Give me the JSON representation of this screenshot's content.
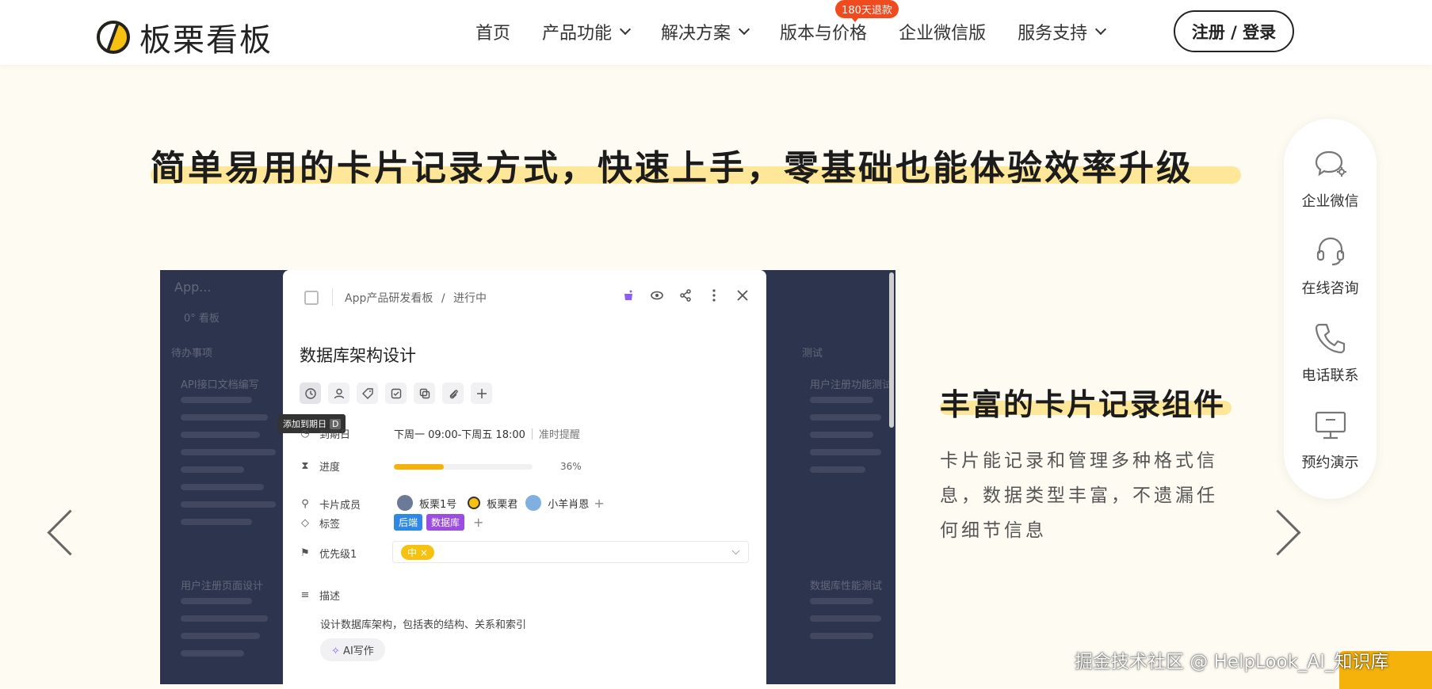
{
  "header": {
    "logo_text": "板栗看板",
    "nav": [
      {
        "label": "首页",
        "dropdown": false
      },
      {
        "label": "产品功能",
        "dropdown": true
      },
      {
        "label": "解决方案",
        "dropdown": true
      },
      {
        "label": "版本与价格",
        "dropdown": false,
        "badge": "180天退款"
      },
      {
        "label": "企业微信版",
        "dropdown": false
      },
      {
        "label": "服务支持",
        "dropdown": true
      }
    ],
    "login_label": "注册 / 登录"
  },
  "headline": "简单易用的卡片记录方式，快速上手，零基础也能体验效率升级",
  "screenshot": {
    "background": {
      "board_title": "App...",
      "view_label": "0° 看板",
      "col_left": "待办事项",
      "col_right": "测试",
      "card1": "API接口文档编写",
      "card2": "用户注册页面设计",
      "card3": "用户注册功能测试",
      "card4": "数据库性能测试"
    },
    "modal": {
      "breadcrumb_board": "App产品研发看板",
      "breadcrumb_sep": "/",
      "breadcrumb_status": "进行中",
      "title": "数据库架构设计",
      "tooltip": "添加到期日",
      "tooltip_key": "D",
      "due_label": "到期日",
      "due_value": "下周一 09:00-下周五 18:00",
      "due_reminder": "准时提醒",
      "progress_label": "进度",
      "progress_value": 36,
      "progress_text": "36%",
      "members_label": "卡片成员",
      "members": [
        "板栗1号",
        "板栗君",
        "小羊肖恩"
      ],
      "tags_label": "标签",
      "tags": [
        {
          "name": "后端",
          "color": "#2f87e6"
        },
        {
          "name": "数据库",
          "color": "#9a4de0"
        }
      ],
      "priority_label": "优先级1",
      "priority_value": "中 ×",
      "desc_label": "描述",
      "desc_text": "设计数据库架构，包括表的结构、关系和索引",
      "ai_button": "AI写作"
    }
  },
  "feature": {
    "title": "丰富的卡片记录组件",
    "desc": "卡片能记录和管理多种格式信息，数据类型丰富，不遗漏任何细节信息"
  },
  "side_panel": [
    {
      "label": "企业微信",
      "icon": "wechat-work-icon"
    },
    {
      "label": "在线咨询",
      "icon": "headset-icon"
    },
    {
      "label": "电话联系",
      "icon": "phone-icon"
    },
    {
      "label": "预约演示",
      "icon": "monitor-icon"
    }
  ],
  "watermark": "掘金技术社区 @ HelpLook_AI_知识库",
  "colors": {
    "accent": "#f7c10f",
    "highlight": "#ffe79a",
    "badge": "#f04a1f",
    "page_bg": "#fdfbf2"
  }
}
